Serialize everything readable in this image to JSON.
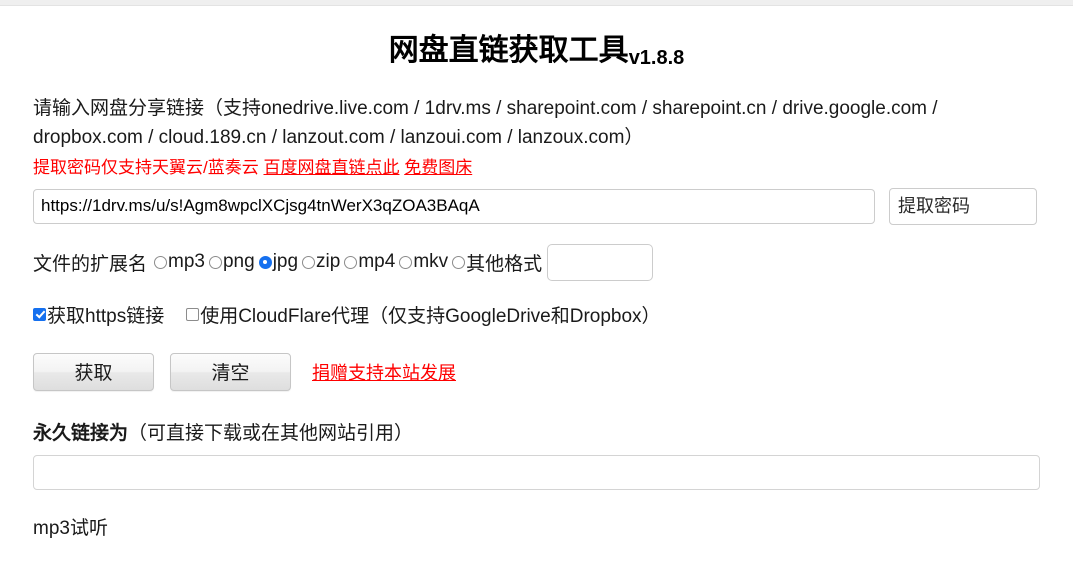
{
  "header": {
    "title": "网盘直链获取工具",
    "version": "v1.8.8"
  },
  "description": {
    "line1": "请输入网盘分享链接（支持onedrive.live.com / 1drv.ms / sharepoint.com / sharepoint.cn / drive.google.com /",
    "line2": "dropbox.com / cloud.189.cn / lanzout.com / lanzoui.com / lanzoux.com）"
  },
  "notice": {
    "text": "提取密码仅支持天翼云/蓝奏云",
    "link_baidu": "百度网盘直链点此",
    "link_imagehost": "免费图床"
  },
  "form": {
    "url_value": "https://1drv.ms/u/s!Agm8wpclXCjsg4tnWerX3qZOA3BAqA",
    "url_placeholder": "",
    "password_value": "",
    "password_placeholder": "提取密码",
    "ext_label": "文件的扩展名",
    "ext_options": [
      {
        "id": "mp3",
        "label": "mp3",
        "checked": false
      },
      {
        "id": "png",
        "label": "png",
        "checked": false
      },
      {
        "id": "jpg",
        "label": "jpg",
        "checked": true
      },
      {
        "id": "zip",
        "label": "zip",
        "checked": false
      },
      {
        "id": "mp4",
        "label": "mp4",
        "checked": false
      },
      {
        "id": "mkv",
        "label": "mkv",
        "checked": false
      },
      {
        "id": "other",
        "label": "其他格式",
        "checked": false
      }
    ],
    "other_ext_value": "",
    "other_ext_placeholder": "",
    "checkbox_https_label": "获取https链接",
    "checkbox_https_checked": true,
    "checkbox_cloudflare_label": "使用CloudFlare代理（仅支持GoogleDrive和Dropbox）",
    "checkbox_cloudflare_checked": false
  },
  "actions": {
    "get_label": "获取",
    "clear_label": "清空",
    "donate_label": "捐赠支持本站发展"
  },
  "result": {
    "title_strong": "永久链接为",
    "title_note": "（可直接下载或在其他网站引用）",
    "output_value": "",
    "output_placeholder": "",
    "mp3_preview_label": "mp3试听"
  },
  "colors": {
    "accent_blue": "#1570ef",
    "link_red": "#ff0000",
    "text": "#1a1a1a"
  }
}
